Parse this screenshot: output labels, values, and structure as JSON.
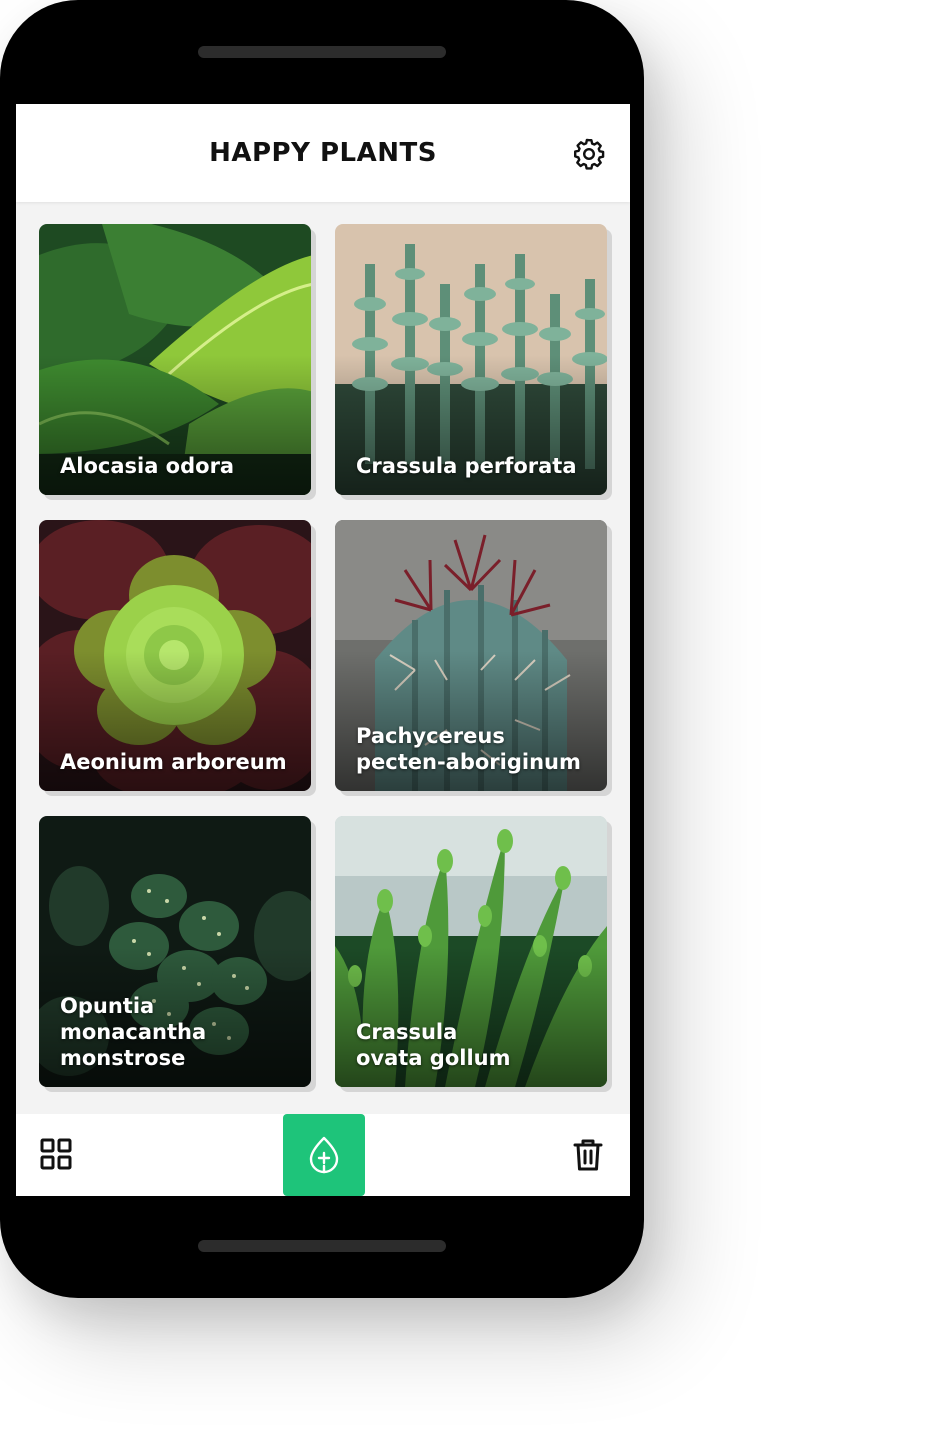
{
  "app": {
    "title": "HAPPY PLANTS",
    "accent_color": "#1ec47a"
  },
  "header": {
    "settings_icon": "gear-icon"
  },
  "plants": [
    {
      "name": "Alocasia odora"
    },
    {
      "name": "Crassula perforata"
    },
    {
      "name": "Aeonium arboreum"
    },
    {
      "name": "Pachycereus pecten-aboriginum"
    },
    {
      "name": "Opuntia monacantha monstrose"
    },
    {
      "name": "Crassula ovata gollum"
    }
  ],
  "bottom_nav": {
    "grid_icon": "grid-view-icon",
    "add_icon": "leaf-plus-icon",
    "trash_icon": "trash-icon"
  }
}
